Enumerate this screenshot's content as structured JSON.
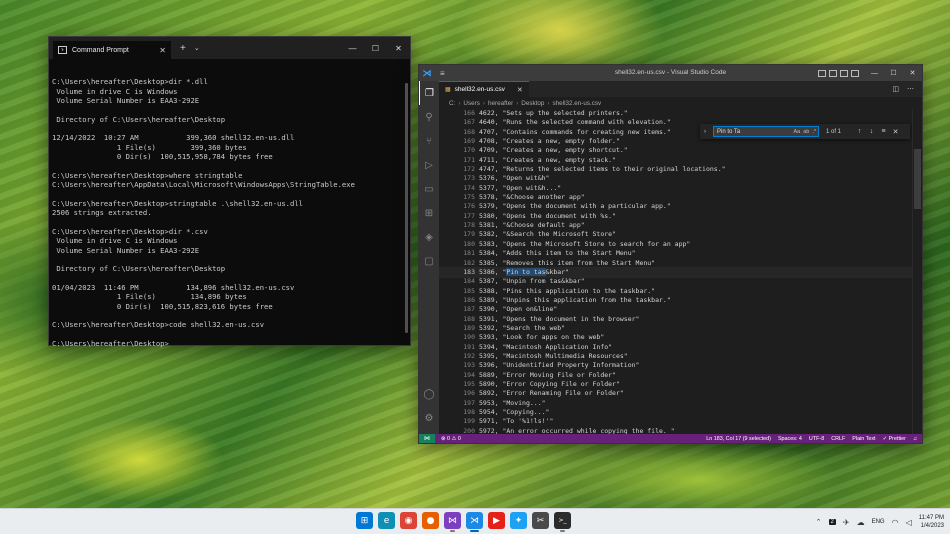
{
  "cmd": {
    "tab_title": "Command Prompt",
    "lines": [
      "",
      "C:\\Users\\hereafter\\Desktop>dir *.dll",
      " Volume in drive C is Windows",
      " Volume Serial Number is EAA3-292E",
      "",
      " Directory of C:\\Users\\hereafter\\Desktop",
      "",
      "12/14/2022  10:27 AM           399,360 shell32.en-us.dll",
      "               1 File(s)        399,360 bytes",
      "               0 Dir(s)  100,515,958,784 bytes free",
      "",
      "C:\\Users\\hereafter\\Desktop>where stringtable",
      "C:\\Users\\hereafter\\AppData\\Local\\Microsoft\\WindowsApps\\StringTable.exe",
      "",
      "C:\\Users\\hereafter\\Desktop>stringtable .\\shell32.en-us.dll",
      "2506 strings extracted.",
      "",
      "C:\\Users\\hereafter\\Desktop>dir *.csv",
      " Volume in drive C is Windows",
      " Volume Serial Number is EAA3-292E",
      "",
      " Directory of C:\\Users\\hereafter\\Desktop",
      "",
      "01/04/2023  11:46 PM           134,896 shell32.en-us.csv",
      "               1 File(s)        134,896 bytes",
      "               0 Dir(s)  100,515,823,616 bytes free",
      "",
      "C:\\Users\\hereafter\\Desktop>code shell32.en-us.csv",
      "",
      "C:\\Users\\hereafter\\Desktop>"
    ]
  },
  "vscode": {
    "window_title": "shell32.en-us.csv - Visual Studio Code",
    "menu_icon": "≡",
    "tab_label": "shell32.en-us.csv",
    "breadcrumb": [
      "C:",
      "Users",
      "hereafter",
      "Desktop",
      "shell32.en-us.csv"
    ],
    "find": {
      "query": "Pin to Ta",
      "options": [
        "Aa",
        "ab",
        ".*"
      ],
      "result": "1 of 1"
    },
    "lines": [
      {
        "n": "166",
        "t": "4622, \"Sets up the selected printers.\""
      },
      {
        "n": "167",
        "t": "4640, \"Runs the selected command with elevation.\""
      },
      {
        "n": "168",
        "t": "4707, \"Contains commands for creating new items.\""
      },
      {
        "n": "169",
        "t": "4708, \"Creates a new, empty folder.\""
      },
      {
        "n": "170",
        "t": "4709, \"Creates a new, empty shortcut.\""
      },
      {
        "n": "171",
        "t": "4711, \"Creates a new, empty stack.\""
      },
      {
        "n": "172",
        "t": "4747, \"Returns the selected items to their original locations.\""
      },
      {
        "n": "173",
        "t": "5376, \"Open wit&h\""
      },
      {
        "n": "174",
        "t": "5377, \"Open wit&h...\""
      },
      {
        "n": "175",
        "t": "5378, \"&Choose another app\""
      },
      {
        "n": "176",
        "t": "5379, \"Opens the document with a particular app.\""
      },
      {
        "n": "177",
        "t": "5380, \"Opens the document with %s.\""
      },
      {
        "n": "178",
        "t": "5381, \"&Choose default app\""
      },
      {
        "n": "179",
        "t": "5382, \"&Search the Microsoft Store\""
      },
      {
        "n": "180",
        "t": "5383, \"Opens the Microsoft Store to search for an app\""
      },
      {
        "n": "181",
        "t": "5384, \"Adds this item to the Start Menu\""
      },
      {
        "n": "182",
        "t": "5385, \"Removes this item from the Start Menu\""
      },
      {
        "n": "183",
        "t": "5386, \"Pin to tas&kbar\"",
        "current": true
      },
      {
        "n": "184",
        "t": "5387, \"Unpin from tas&kbar\""
      },
      {
        "n": "185",
        "t": "5388, \"Pins this application to the taskbar.\""
      },
      {
        "n": "186",
        "t": "5389, \"Unpins this application from the taskbar.\""
      },
      {
        "n": "187",
        "t": "5390, \"Open on&line\""
      },
      {
        "n": "188",
        "t": "5391, \"Opens the document in the browser\""
      },
      {
        "n": "189",
        "t": "5392, \"Search the web\""
      },
      {
        "n": "190",
        "t": "5393, \"Look for apps on the web\""
      },
      {
        "n": "191",
        "t": "5394, \"Macintosh Application Info\""
      },
      {
        "n": "192",
        "t": "5395, \"Macintosh Multimedia Resources\""
      },
      {
        "n": "193",
        "t": "5396, \"Unidentified Property Information\""
      },
      {
        "n": "194",
        "t": "5889, \"Error Moving File or Folder\""
      },
      {
        "n": "195",
        "t": "5890, \"Error Copying File or Folder\""
      },
      {
        "n": "196",
        "t": "5892, \"Error Renaming File or Folder\""
      },
      {
        "n": "197",
        "t": "5953, \"Moving...\""
      },
      {
        "n": "198",
        "t": "5954, \"Copying...\""
      },
      {
        "n": "199",
        "t": "5971, \"To '%1!ls!'\""
      },
      {
        "n": "200",
        "t": "5972, \"An error occurred while copying the file. \""
      }
    ],
    "current_line": {
      "prefix": "5386, \"",
      "selected": "Pin to tas",
      "suffix": "&kbar\""
    },
    "status": {
      "problems": "⊗ 0 ⚠ 0",
      "position": "Ln 183, Col 17 (9 selected)",
      "spaces": "Spaces: 4",
      "encoding": "UTF-8",
      "eol": "CRLF",
      "language": "Plain Text",
      "formatter": "✓ Prettier"
    },
    "colors": {
      "statusbar": "#68217a",
      "accent": "#007acc"
    }
  },
  "taskbar": {
    "apps": [
      {
        "name": "start",
        "glyph": "⊞",
        "color": "#0078d4"
      },
      {
        "name": "edge",
        "glyph": "e",
        "color": "#0f8fb4"
      },
      {
        "name": "chrome",
        "glyph": "◉",
        "color": "#db4437"
      },
      {
        "name": "firefox",
        "glyph": "●",
        "color": "#e66000"
      },
      {
        "name": "visual-studio",
        "glyph": "⋈",
        "color": "#7b3fbf"
      },
      {
        "name": "vscode",
        "glyph": "⋊",
        "color": "#1e88e5"
      },
      {
        "name": "youtube",
        "glyph": "▶",
        "color": "#e62117"
      },
      {
        "name": "twitter",
        "glyph": "✦",
        "color": "#1da1f2"
      },
      {
        "name": "snipping-tool",
        "glyph": "✂",
        "color": "#4a4a4a"
      },
      {
        "name": "terminal",
        "glyph": ">_",
        "color": "#2b2b2b"
      }
    ],
    "tray": {
      "notification_count": "2",
      "language": "ENG",
      "time": "11:47 PM",
      "date": "1/4/2023"
    }
  }
}
